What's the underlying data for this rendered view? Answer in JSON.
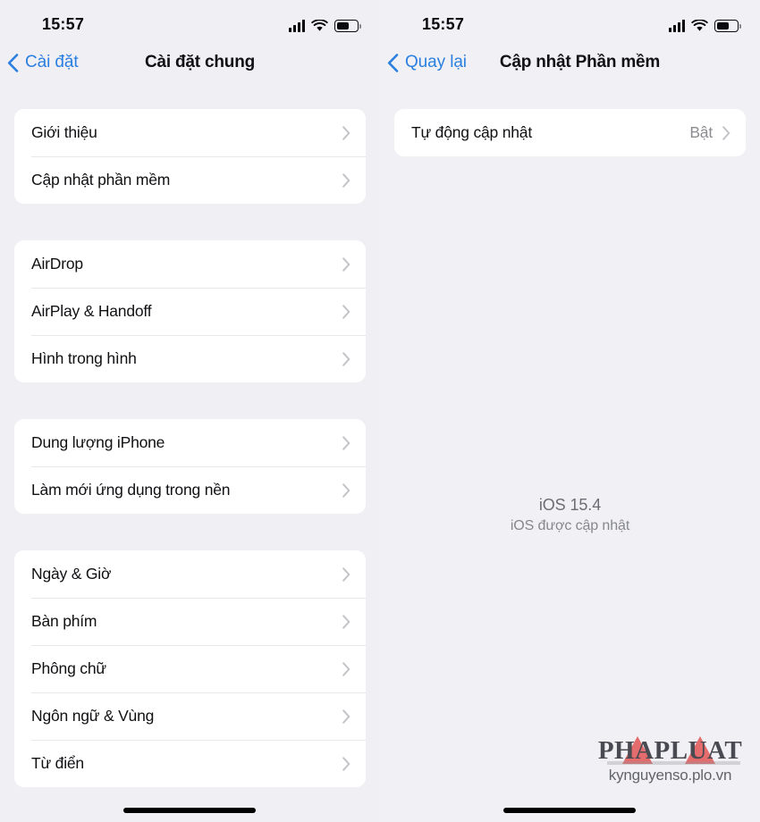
{
  "screens": [
    {
      "statusbar": {
        "time": "15:57",
        "signal_icon": "cellular-signal-icon",
        "wifi_icon": "wifi-icon",
        "battery_icon": "battery-icon",
        "battery_level": 62
      },
      "nav": {
        "back_label": "Cài đặt",
        "back_icon": "chevron-left-icon",
        "title": "Cài đặt chung"
      },
      "groups": [
        {
          "rows": [
            {
              "label": "Giới thiệu",
              "value": "",
              "chevron": "chevron-right-icon"
            },
            {
              "label": "Cập nhật phần mềm",
              "value": "",
              "chevron": "chevron-right-icon"
            }
          ]
        },
        {
          "rows": [
            {
              "label": "AirDrop",
              "value": "",
              "chevron": "chevron-right-icon"
            },
            {
              "label": "AirPlay & Handoff",
              "value": "",
              "chevron": "chevron-right-icon"
            },
            {
              "label": "Hình trong hình",
              "value": "",
              "chevron": "chevron-right-icon"
            }
          ]
        },
        {
          "rows": [
            {
              "label": "Dung lượng iPhone",
              "value": "",
              "chevron": "chevron-right-icon"
            },
            {
              "label": "Làm mới ứng dụng trong nền",
              "value": "",
              "chevron": "chevron-right-icon"
            }
          ]
        },
        {
          "rows": [
            {
              "label": "Ngày & Giờ",
              "value": "",
              "chevron": "chevron-right-icon"
            },
            {
              "label": "Bàn phím",
              "value": "",
              "chevron": "chevron-right-icon"
            },
            {
              "label": "Phông chữ",
              "value": "",
              "chevron": "chevron-right-icon"
            },
            {
              "label": "Ngôn ngữ & Vùng",
              "value": "",
              "chevron": "chevron-right-icon"
            },
            {
              "label": "Từ điển",
              "value": "",
              "chevron": "chevron-right-icon"
            }
          ]
        }
      ]
    },
    {
      "statusbar": {
        "time": "15:57",
        "signal_icon": "cellular-signal-icon",
        "wifi_icon": "wifi-icon",
        "battery_icon": "battery-icon",
        "battery_level": 62
      },
      "nav": {
        "back_label": "Quay lại",
        "back_icon": "chevron-left-icon",
        "title": "Cập nhật Phần mềm"
      },
      "groups": [
        {
          "rows": [
            {
              "label": "Tự động cập nhật",
              "value": "Bật",
              "chevron": "chevron-right-icon"
            }
          ]
        }
      ],
      "update_status": {
        "version": "iOS 15.4",
        "message": "iOS được cập nhật"
      },
      "watermark": {
        "logo_text": "PHAPLUAT",
        "url": "kynguyenso.plo.vn"
      }
    }
  ],
  "colors": {
    "background": "#f1f1f5",
    "card": "#ffffff",
    "accent_blue": "#2a7fe0",
    "primary_text": "#111114",
    "secondary_text": "#8c8c92",
    "separator": "#e8e8ea",
    "watermark_red": "#e24e4e"
  }
}
